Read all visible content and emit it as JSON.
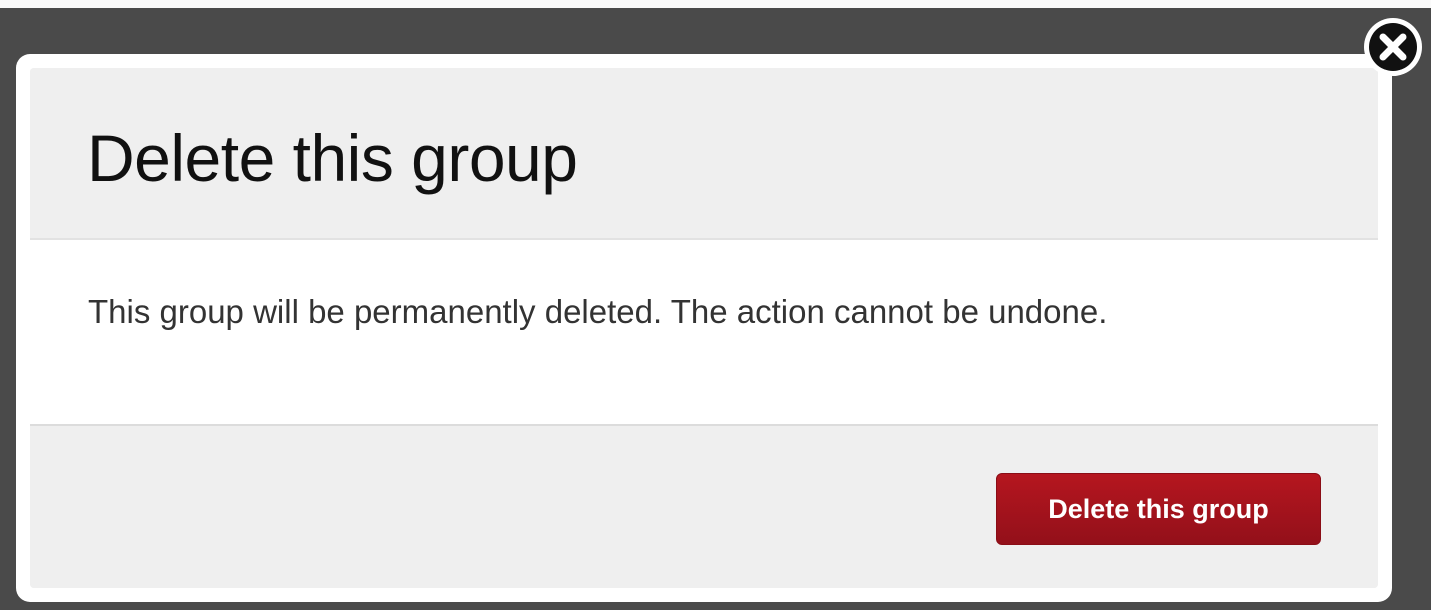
{
  "dialog": {
    "title": "Delete this group",
    "message": "This group will be permanently deleted. The action cannot be undone.",
    "primary_button_label": "Delete this group",
    "close_icon": "close-icon"
  },
  "colors": {
    "backdrop": "#4a4a4a",
    "dialog_header": "#efefef",
    "dialog_body": "#ffffff",
    "danger_button": "#a5131d",
    "danger_button_text": "#ffffff"
  }
}
